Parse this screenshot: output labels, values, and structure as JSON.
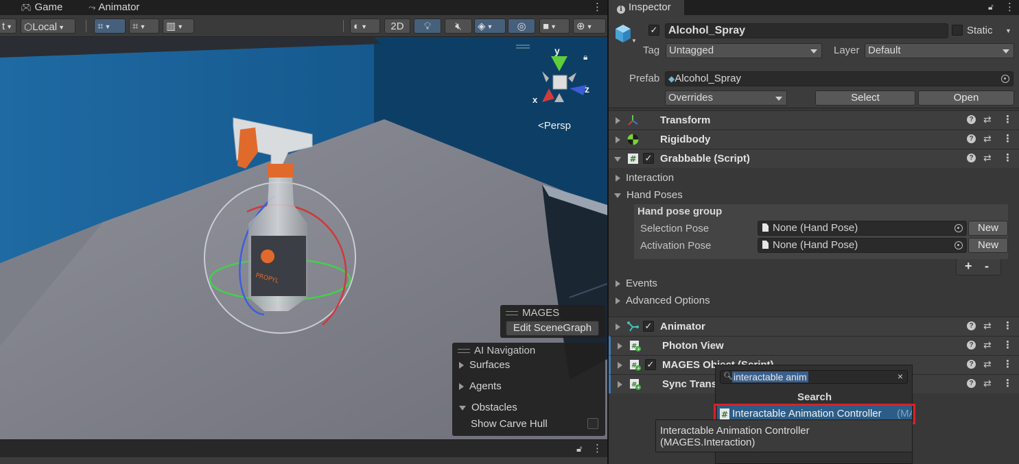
{
  "scene_tabs": {
    "game": "Game",
    "animator": "Animator"
  },
  "toolbar": {
    "partial_label": "t",
    "pivot_rotation": "Local",
    "mode_2d": "2D"
  },
  "gizmo": {
    "y": "y",
    "x": "x",
    "z": "z",
    "projection": "Persp"
  },
  "mages_overlay": {
    "title": "MAGES",
    "button": "Edit SceneGraph"
  },
  "ai_navigation": {
    "title": "AI Navigation",
    "surfaces": "Surfaces",
    "agents": "Agents",
    "obstacles": "Obstacles",
    "show_carve_hull": "Show Carve Hull"
  },
  "inspector": {
    "tab": "Inspector",
    "object_name": "Alcohol_Spray",
    "static_label": "Static",
    "tag_label": "Tag",
    "tag_value": "Untagged",
    "layer_label": "Layer",
    "layer_value": "Default",
    "prefab_label": "Prefab",
    "prefab_value": "Alcohol_Spray",
    "overrides": "Overrides",
    "select": "Select",
    "open": "Open"
  },
  "components": {
    "transform": "Transform",
    "rigidbody": "Rigidbody",
    "grabbable": "Grabbable (Script)",
    "interaction": "Interaction",
    "hand_poses": "Hand Poses",
    "hand_pose_group": "Hand pose group",
    "selection_pose_label": "Selection Pose",
    "selection_pose_value": "None (Hand Pose)",
    "activation_pose_label": "Activation Pose",
    "activation_pose_value": "None (Hand Pose)",
    "new_label": "New",
    "plus": "+",
    "minus": "-",
    "events": "Events",
    "advanced_options": "Advanced Options",
    "animator": "Animator",
    "photon_view": "Photon View",
    "mages_object": "MAGES Object (Script)",
    "sync_transform": "Sync Transform"
  },
  "add_component": {
    "search_value": "interactable anim",
    "section": "Search",
    "result": "Interactable Animation Controller",
    "result_suffix": "(MA",
    "tooltip_line1": "Interactable Animation Controller",
    "tooltip_line2": "(MAGES.Interaction)"
  },
  "colors": {
    "highlight_red": "#d8222a",
    "selection_blue": "#2c5d87",
    "editor_bg": "#383838"
  }
}
